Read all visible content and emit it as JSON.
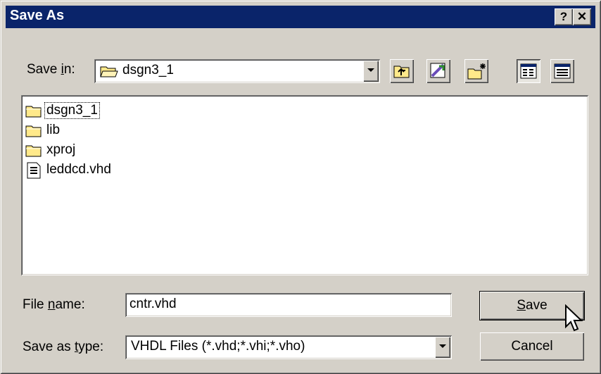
{
  "window": {
    "title": "Save As"
  },
  "titlebar": {
    "help_label": "?",
    "close_label": "✕"
  },
  "save_in": {
    "label_pre": "Save ",
    "label_key": "i",
    "label_post": "n:",
    "value": "dsgn3_1"
  },
  "toolbar": {
    "up_icon": "up-folder-icon",
    "desktop_icon": "desktop-icon",
    "new_folder_icon": "new-folder-icon",
    "list_view_icon": "list-view-icon",
    "details_view_icon": "details-view-icon"
  },
  "files": [
    {
      "name": "dsgn3_1",
      "icon": "folder-icon"
    },
    {
      "name": "lib",
      "icon": "folder-icon"
    },
    {
      "name": "xproj",
      "icon": "folder-icon"
    },
    {
      "name": "leddcd.vhd",
      "icon": "document-icon"
    }
  ],
  "filename": {
    "label_pre": "File ",
    "label_key": "n",
    "label_post": "ame:",
    "value": "cntr.vhd"
  },
  "filetype": {
    "label_pre": "Save as ",
    "label_key": "t",
    "label_post": "ype:",
    "value": "VHDL Files (*.vhd;*.vhi;*.vho)"
  },
  "buttons": {
    "save_key": "S",
    "save_rest": "ave",
    "cancel": "Cancel"
  },
  "colors": {
    "titlebar": "#0a246a",
    "face": "#d4d0c8",
    "folder": "#ffe98a"
  }
}
